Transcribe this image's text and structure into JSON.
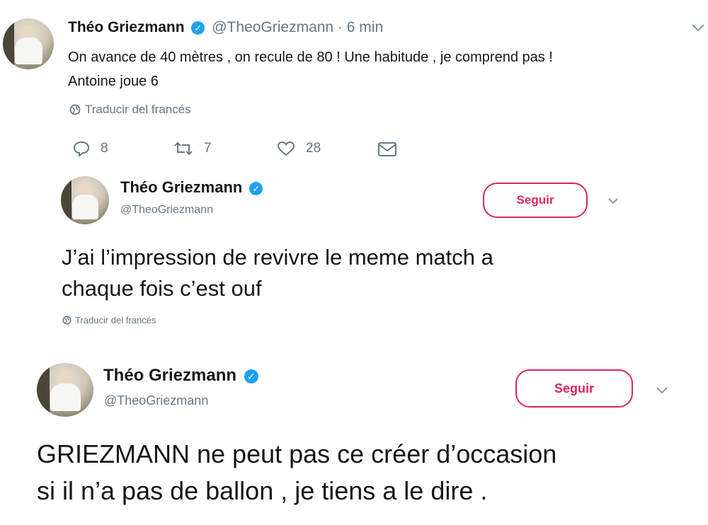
{
  "tweet1": {
    "name": "Théo Griezmann",
    "handle": "@TheoGriezmann",
    "separator": "·",
    "time": "6 min",
    "text_line1": "On avance de 40 mètres , on recule de 80 ! Une habitude , je comprend pas !",
    "text_line2": "Antoine joue 6",
    "translate": "Traducir del francés",
    "replies": "8",
    "retweets": "7",
    "likes": "28"
  },
  "tweet2": {
    "name": "Théo Griezmann",
    "handle": "@TheoGriezmann",
    "follow": "Seguir",
    "text_line1": "J’ai l’impression de revivre le meme  match a",
    "text_line2": "chaque fois c’est ouf",
    "translate": "Traducir del francés"
  },
  "tweet3": {
    "name": "Théo Griezmann",
    "handle": "@TheoGriezmann",
    "follow": "Seguir",
    "text_line1": "GRIEZMANN ne peut pas ce créer d’occasion",
    "text_line2": "si il n’a pas de ballon , je tiens a le dire ."
  },
  "icons": [
    "chevron-down-icon",
    "verified-badge-icon",
    "globe-icon",
    "reply-icon",
    "retweet-icon",
    "like-icon",
    "message-icon"
  ],
  "colors": {
    "verified": "#1da1f2",
    "follow": "#e0245e",
    "muted": "#657786"
  }
}
